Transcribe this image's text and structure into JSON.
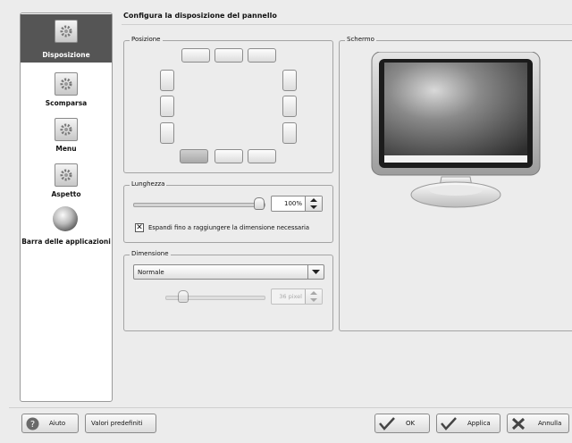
{
  "sidebar": {
    "items": [
      {
        "label": "Disposizione",
        "selected": true,
        "icon": "kde-gear-icon"
      },
      {
        "label": "Scomparsa",
        "selected": false,
        "icon": "kde-gear-icon"
      },
      {
        "label": "Menu",
        "selected": false,
        "icon": "kde-gear-icon"
      },
      {
        "label": "Aspetto",
        "selected": false,
        "icon": "kde-gear-icon"
      },
      {
        "label": "Barra delle applicazioni",
        "selected": false,
        "icon": "globe-icon"
      }
    ]
  },
  "page": {
    "title": "Configura la disposizione del pannello"
  },
  "position": {
    "label": "Posizione",
    "selected": "bottom-left"
  },
  "length": {
    "label": "Lunghezza",
    "value": "100%",
    "slider_fraction": 1.0,
    "expand_checked": true,
    "expand_label": "Espandi fino a raggiungere la dimensione necessaria"
  },
  "size": {
    "label": "Dimensione",
    "selected": "Normale",
    "custom_value": "36 pixel"
  },
  "screen": {
    "label": "Schermo"
  },
  "buttons": {
    "help": "Aiuto",
    "defaults": "Valori predefiniti",
    "ok": "OK",
    "apply": "Applica",
    "cancel": "Annulla"
  },
  "colors": {
    "selected_bg": "#555555",
    "window_bg": "#ececec"
  }
}
